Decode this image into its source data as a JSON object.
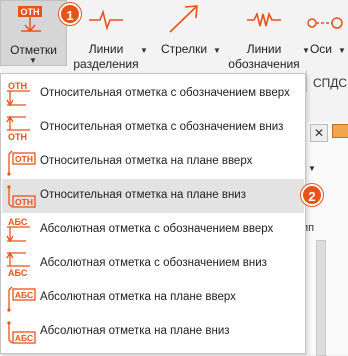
{
  "ribbon": {
    "buttons": [
      {
        "id": "otmetki",
        "label": "Отметки",
        "icon": "elevation-mark-icon",
        "has_dropdown": true
      },
      {
        "id": "linii_razdeleniya",
        "label_line1": "Линии",
        "label_line2": "разделения",
        "icon": "break-line-icon",
        "has_dropdown": true
      },
      {
        "id": "strelki",
        "label": "Стрелки",
        "icon": "arrow-icon",
        "has_dropdown": true
      },
      {
        "id": "linii_oboznacheniya",
        "label_line1": "Линии",
        "label_line2": "обозначения",
        "icon": "designation-line-icon",
        "has_dropdown": true
      },
      {
        "id": "osi",
        "label": "Оси",
        "icon": "axes-icon",
        "has_dropdown": true
      }
    ],
    "group_label": "СПДС",
    "icon_text": "ОТН"
  },
  "callouts": {
    "first": "1",
    "second": "2"
  },
  "pane": {
    "close_glyph": "✕",
    "text": "ип",
    "dropdown_glyph": "▼"
  },
  "menu": {
    "items": [
      {
        "label": "Относительная отметка с обозначением вверх",
        "icon": "relative-mark-up-icon",
        "icon_text": "ОТН"
      },
      {
        "label": "Относительная отметка с обозначением вниз",
        "icon": "relative-mark-down-icon",
        "icon_text": "ОТН"
      },
      {
        "label": "Относительная отметка на плане вверх",
        "icon": "relative-plan-mark-up-icon",
        "icon_text": "ОТН"
      },
      {
        "label": "Относительная отметка на плане вниз",
        "icon": "relative-plan-mark-down-icon",
        "icon_text": "ОТН"
      },
      {
        "label": "Абсолютная отметка с обозначением вверх",
        "icon": "absolute-mark-up-icon",
        "icon_text": "АБС"
      },
      {
        "label": "Абсолютная отметка с обозначением вниз",
        "icon": "absolute-mark-down-icon",
        "icon_text": "АБС"
      },
      {
        "label": "Абсолютная отметка на плане вверх",
        "icon": "absolute-plan-mark-up-icon",
        "icon_text": "АБС"
      },
      {
        "label": "Абсолютная отметка на плане вниз",
        "icon": "absolute-plan-mark-down-icon",
        "icon_text": "АБС"
      }
    ],
    "hovered_index": 3
  },
  "colors": {
    "accent": "#e8531a",
    "icon_orange": "#e8531a",
    "hover_bg": "#e3e3e3"
  }
}
